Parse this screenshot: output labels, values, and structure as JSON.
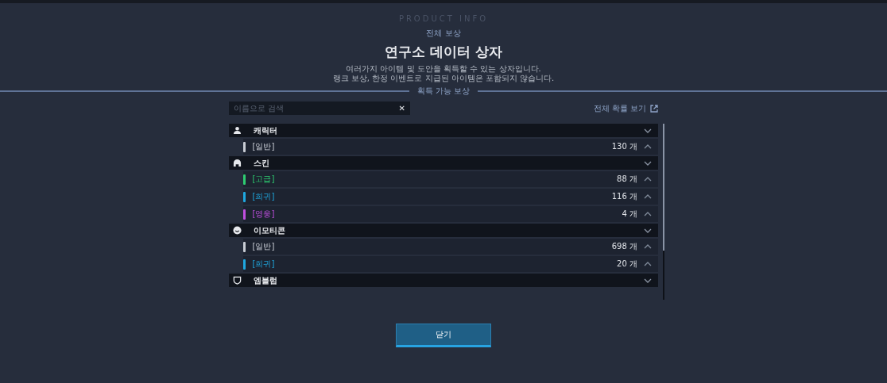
{
  "header": {
    "eyebrow": "PRODUCT INFO",
    "subtitle": "전체 보상",
    "title": "연구소 데이터 상자",
    "description": [
      "여러가지 아이템 및 도안을 획득할 수 있는 상자입니다.",
      "랭크 보상, 한정 이벤트로 지급된 아이템은 포함되지 않습니다."
    ]
  },
  "section_title": "획득 가능 보상",
  "search": {
    "placeholder": "이름으로 검색",
    "clear": "✕"
  },
  "view_all_link": "전체 확률 보기",
  "categories": [
    {
      "name": "캐릭터",
      "kind": "person",
      "expanded": true,
      "items": [
        {
          "grade": "[일반]",
          "color": "#c8ccd4",
          "count": "130 개",
          "expanded": false
        }
      ]
    },
    {
      "name": "스킨",
      "kind": "helmet",
      "expanded": true,
      "items": [
        {
          "grade": "[고급]",
          "color": "#2ecc71",
          "count": "88 개",
          "expanded": false
        },
        {
          "grade": "[희귀]",
          "color": "#1fa8e0",
          "count": "116 개",
          "expanded": false
        },
        {
          "grade": "[영웅]",
          "color": "#c04fe0",
          "count": "4 개",
          "expanded": false
        }
      ]
    },
    {
      "name": "이모티콘",
      "kind": "smile",
      "expanded": true,
      "items": [
        {
          "grade": "[일반]",
          "color": "#c8ccd4",
          "count": "698 개",
          "expanded": false
        },
        {
          "grade": "[희귀]",
          "color": "#1fa8e0",
          "count": "20 개",
          "expanded": false
        }
      ]
    },
    {
      "name": "엠블럼",
      "kind": "shield",
      "expanded": true
    }
  ],
  "close_button": "닫기"
}
